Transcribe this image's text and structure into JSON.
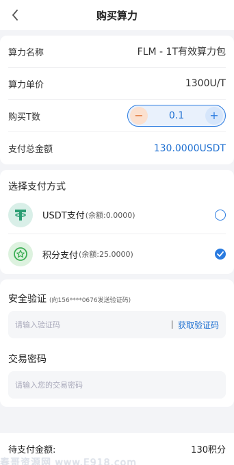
{
  "header": {
    "title": "购买算力"
  },
  "info": {
    "name_label": "算力名称",
    "name_value": "FLM - 1T有效算力包",
    "price_label": "算力单价",
    "price_value": "1300U/T",
    "qty_label": "购买T数",
    "qty_value": "0.1",
    "minus": "−",
    "plus": "+",
    "total_label": "支付总金额",
    "total_value": "130.0000USDT"
  },
  "payment": {
    "title": "选择支付方式",
    "methods": [
      {
        "name": "USDT支付",
        "balance": "(余额:0.0000)",
        "selected": false
      },
      {
        "name": "积分支付",
        "balance": "(余额:25.0000)",
        "selected": true
      }
    ]
  },
  "verify": {
    "title": "安全验证",
    "hint": "(向156****0676发送验证码)",
    "code_placeholder": "请输入验证码",
    "get_code": "获取验证码",
    "pwd_title": "交易密码",
    "pwd_placeholder": "请输入您的交易密码"
  },
  "footer": {
    "label": "待支付金额:",
    "amount": "130积分"
  },
  "watermark": "春哥资源网 www.E918.com",
  "colors": {
    "accent": "#2a7be0",
    "minus": "#e07030",
    "usdt_green": "#2a9d72",
    "points_green": "#3cae54"
  }
}
